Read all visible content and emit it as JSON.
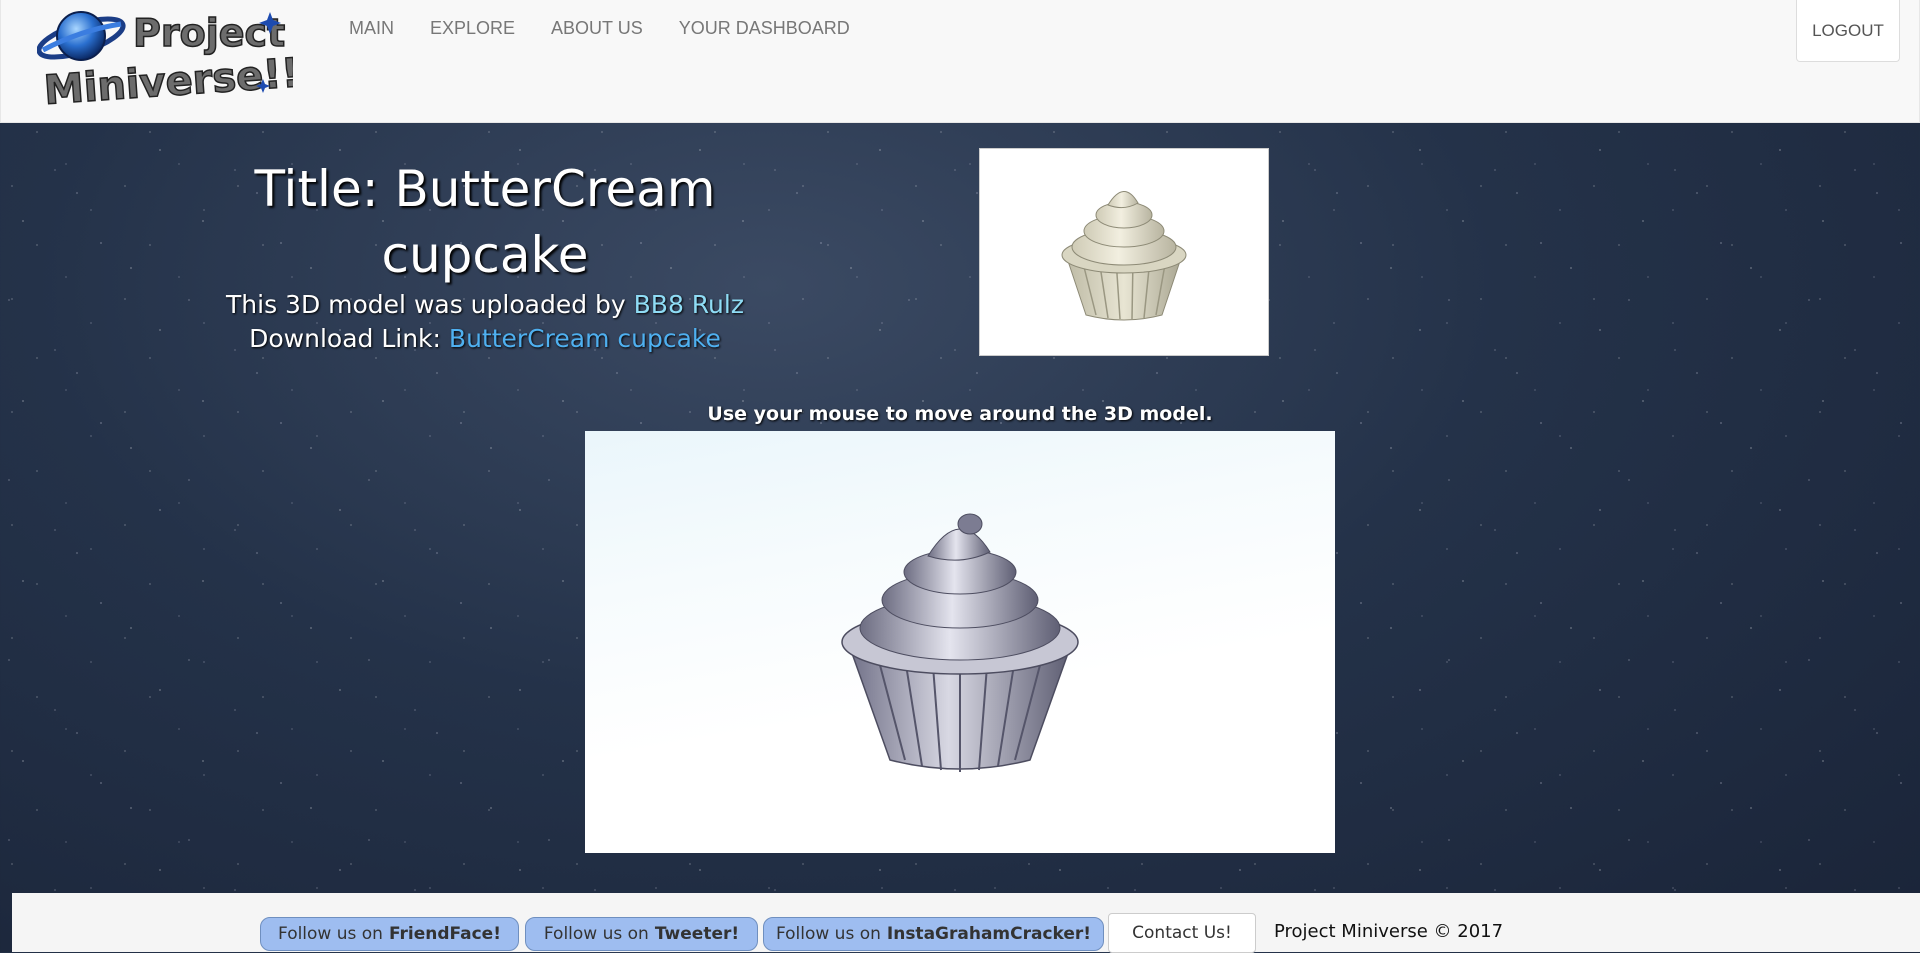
{
  "nav": {
    "logo_text": "Project Miniverse!!",
    "items": [
      "MAIN",
      "EXPLORE",
      "ABOUT US",
      "YOUR DASHBOARD"
    ],
    "logout": "LOGOUT"
  },
  "model": {
    "title": "Title: ButterCream cupcake",
    "uploaded_prefix": "This 3D model was uploaded by",
    "uploader": "BB8 Rulz",
    "download_prefix": "Download Link:",
    "download_name": "ButterCream cupcake",
    "instructions": "Use your mouse to move around the 3D model."
  },
  "footer": {
    "friendface_prefix": "Follow us on",
    "friendface": "FriendFace!",
    "tweeter_prefix": "Follow us on",
    "tweeter": "Tweeter!",
    "insta_prefix": "Follow us on",
    "insta": "InstaGrahamCracker!",
    "contact": "Contact Us!",
    "copyright": "Project Miniverse © 2017"
  },
  "colors": {
    "link_light": "#8fdcf5",
    "link_blue": "#4fb0f0",
    "social_button": "#9ebdf0"
  }
}
